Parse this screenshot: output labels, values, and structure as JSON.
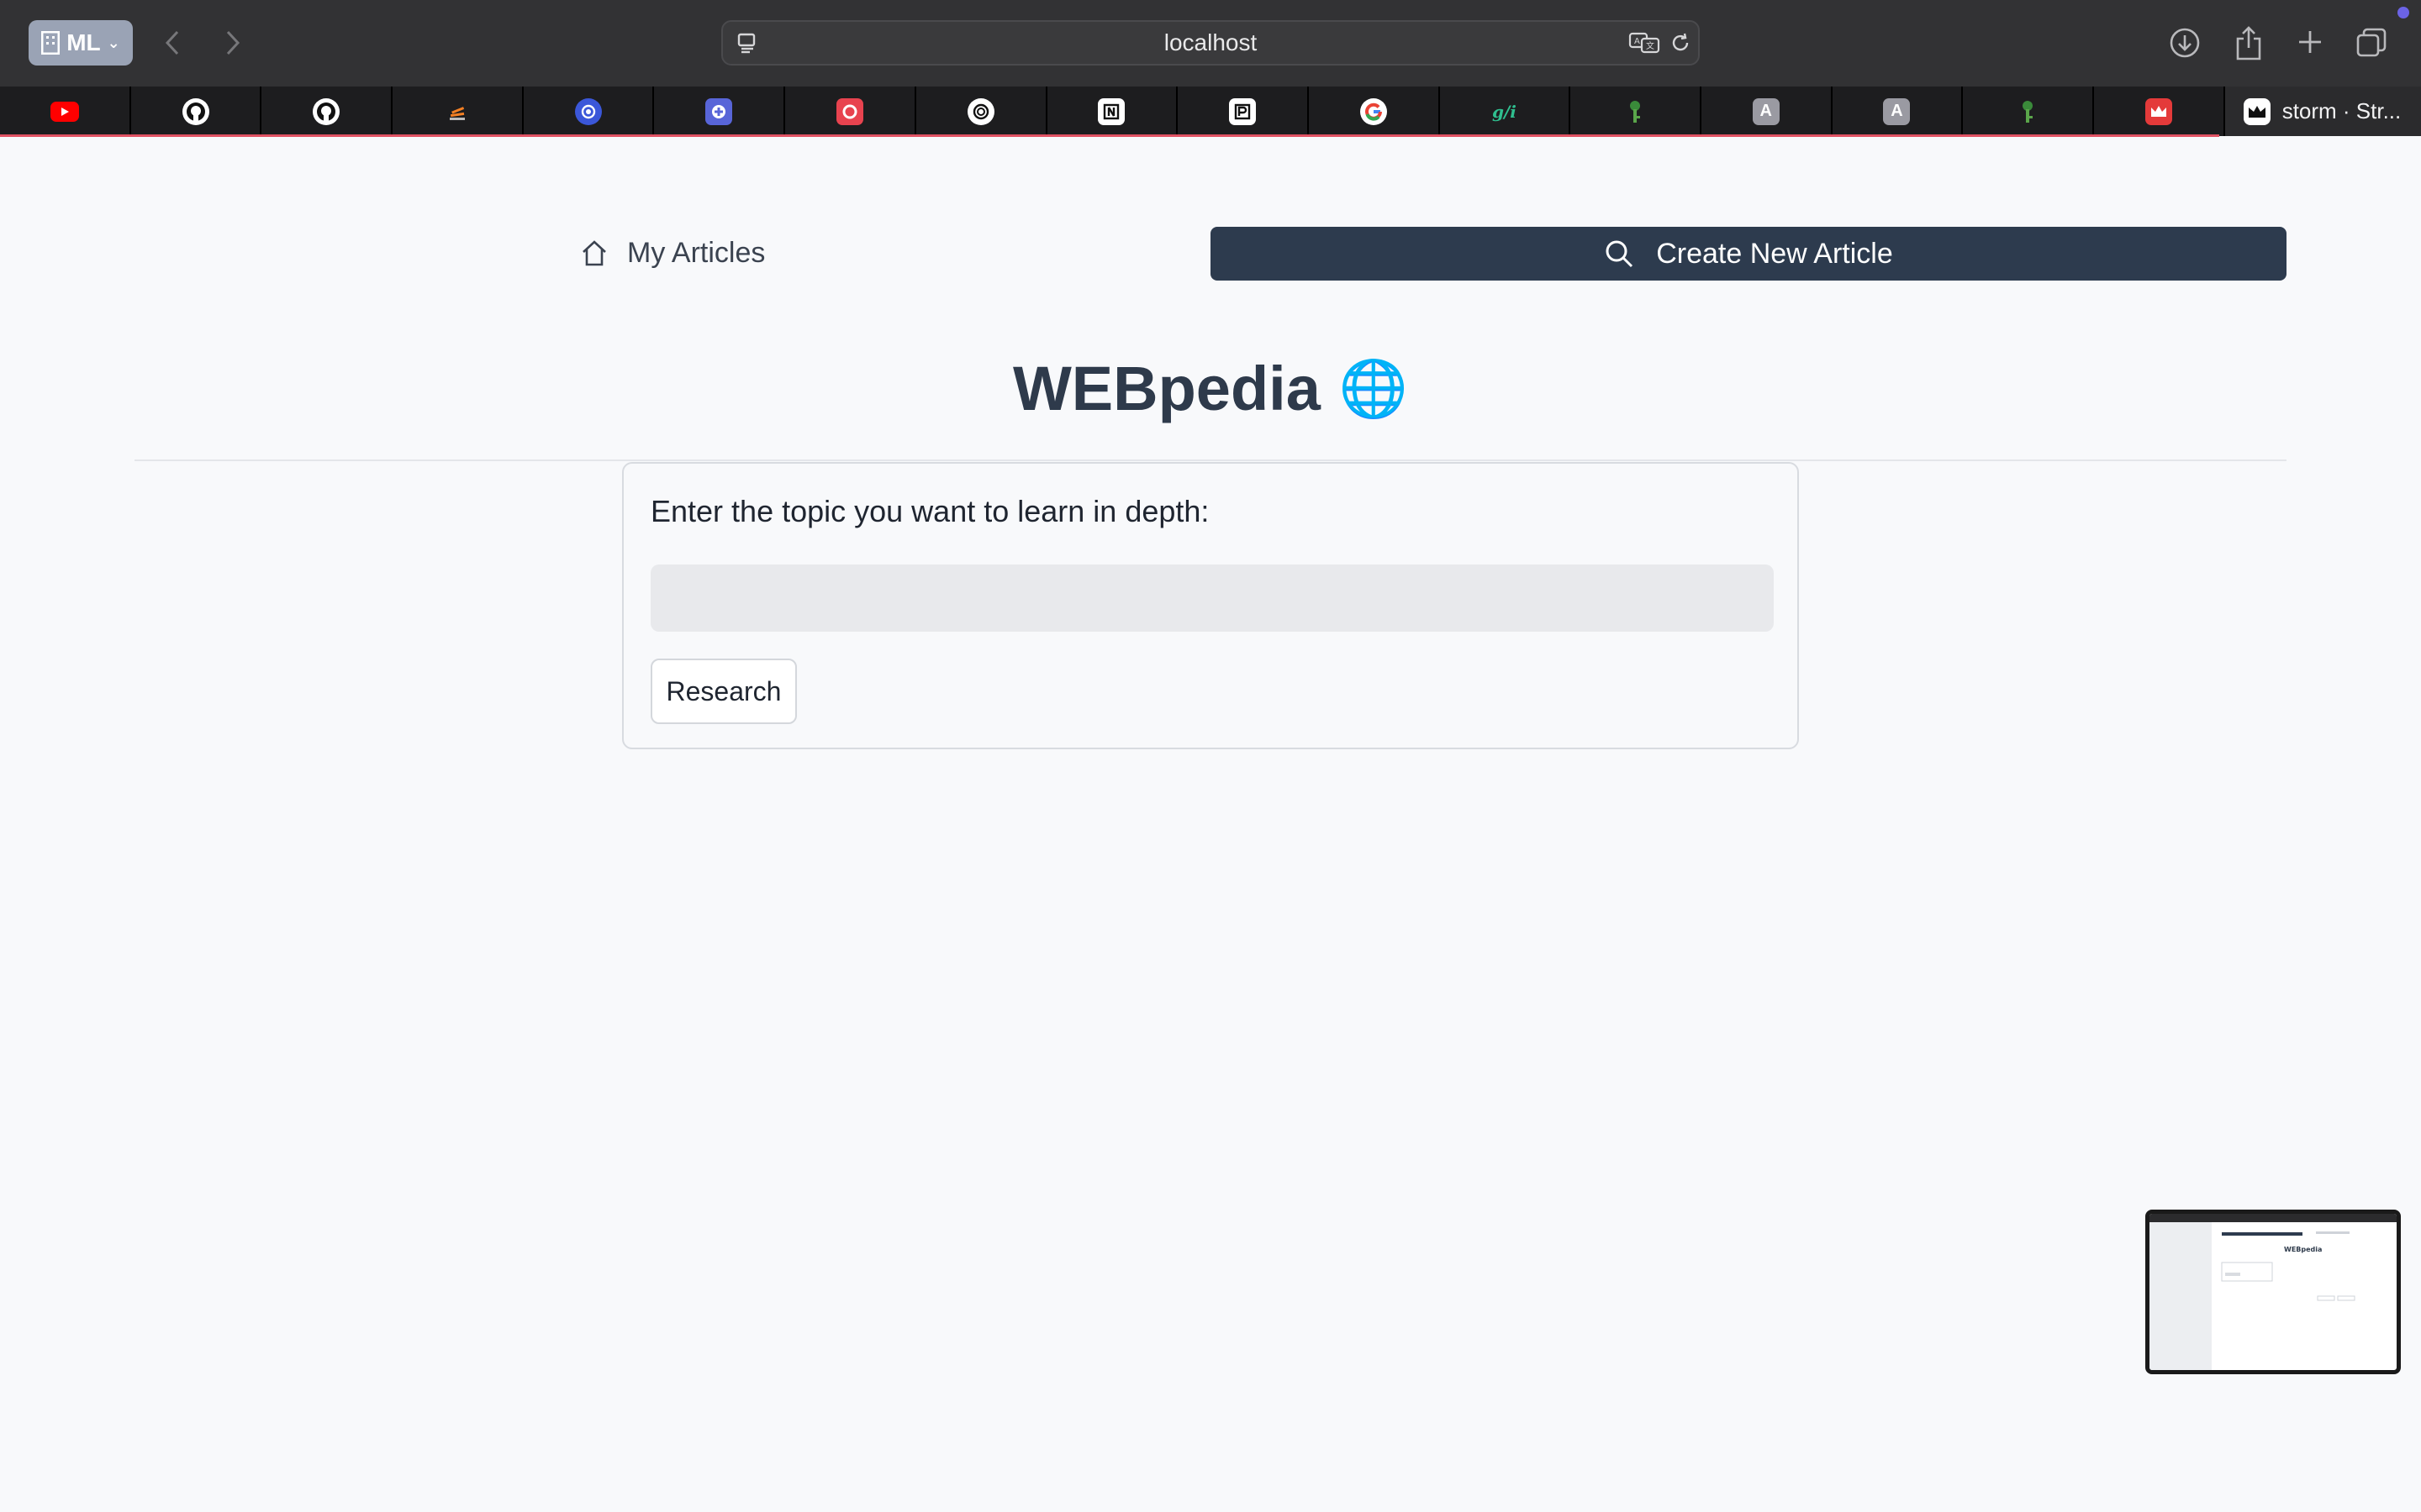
{
  "browser": {
    "profile_label": "ML",
    "url": "localhost",
    "active_tab_title": "storm · Str...",
    "tab_favicons": [
      "youtube-icon",
      "github-icon",
      "github-icon",
      "stackoverflow-icon",
      "openai-blue-icon",
      "plus-box-icon",
      "red-o-icon",
      "chatgpt-icon",
      "notion-icon",
      "paper-icon",
      "google-icon",
      "gfi-icon",
      "key-icon",
      "letter-a-icon",
      "letter-a-icon",
      "key-icon",
      "crown-red-icon"
    ],
    "gfi_text": "g/i",
    "a_text": "A"
  },
  "nav": {
    "my_articles": "My Articles",
    "create_new": "Create New Article"
  },
  "page": {
    "title": "WEBpedia",
    "title_emoji": "🌐",
    "prompt_label": "Enter the topic you want to learn in depth:",
    "topic_value": "",
    "research_label": "Research"
  },
  "thumbnail": {
    "title": "WEBpedia"
  },
  "colors": {
    "primary_button": "#2d3b4e",
    "title": "#2e3a4b",
    "page_bg": "#f8f9fb"
  }
}
